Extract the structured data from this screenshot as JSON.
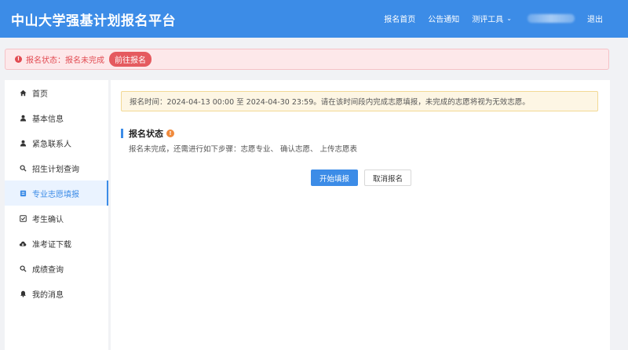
{
  "header": {
    "brand": "中山大学强基计划报名平台",
    "nav": [
      {
        "label": "报名首页"
      },
      {
        "label": "公告通知"
      },
      {
        "label": "测评工具"
      },
      {
        "label": "退出"
      }
    ],
    "tools_chevron": "⌄"
  },
  "alert": {
    "status_text": "报名状态：报名未完成",
    "goto_label": "前往报名"
  },
  "sidebar": {
    "items": [
      {
        "label": "首页",
        "icon": "home-icon"
      },
      {
        "label": "基本信息",
        "icon": "user-icon"
      },
      {
        "label": "紧急联系人",
        "icon": "user-icon"
      },
      {
        "label": "招生计划查询",
        "icon": "search-icon"
      },
      {
        "label": "专业志愿填报",
        "icon": "form-icon"
      },
      {
        "label": "考生确认",
        "icon": "check-icon"
      },
      {
        "label": "准考证下载",
        "icon": "cloud-download-icon"
      },
      {
        "label": "成绩查询",
        "icon": "search-icon"
      },
      {
        "label": "我的消息",
        "icon": "bell-icon"
      }
    ],
    "active_index": 4
  },
  "main": {
    "notice": "报名时间：2024-04-13 00:00 至 2024-04-30 23:59。请在该时间段内完成志愿填报，未完成的志愿将视为无效志愿。",
    "section_title": "报名状态",
    "steps_text": "报名未完成，还需进行如下步骤：志愿专业、 确认志愿、 上传志愿表",
    "start_button": "开始填报",
    "cancel_button": "取消报名"
  },
  "colors": {
    "primary": "#3c8ce7",
    "danger": "#e24b52",
    "warning_bg": "#fdf6e4",
    "info_orange": "#f08a3c"
  }
}
